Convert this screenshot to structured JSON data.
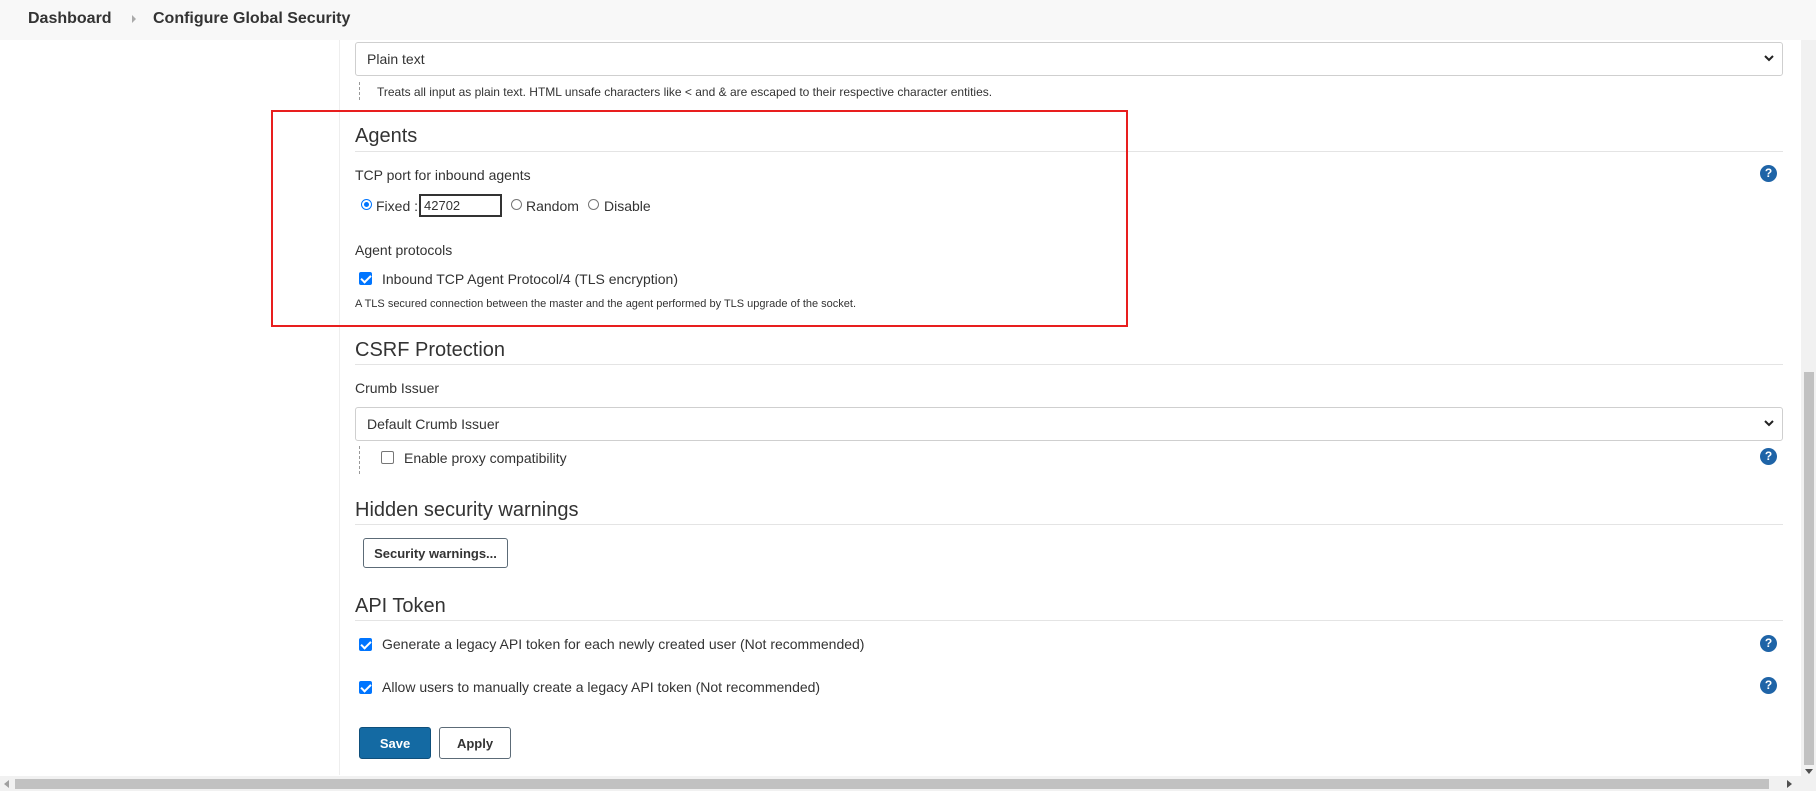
{
  "breadcrumb": {
    "items": [
      "Dashboard",
      "Configure Global Security"
    ]
  },
  "markup_formatter": {
    "selected": "Plain text",
    "description": "Treats all input as plain text. HTML unsafe characters like < and & are escaped to their respective character entities."
  },
  "agents": {
    "title": "Agents",
    "tcp_port_label": "TCP port for inbound agents",
    "options": {
      "fixed_label": "Fixed :",
      "fixed_value": "42702",
      "random_label": "Random",
      "disable_label": "Disable",
      "selected": "Fixed"
    },
    "protocols_label": "Agent protocols",
    "protocol": {
      "label": "Inbound TCP Agent Protocol/4 (TLS encryption)",
      "checked": true,
      "description": "A TLS secured connection between the master and the agent performed by TLS upgrade of the socket."
    }
  },
  "csrf": {
    "title": "CSRF Protection",
    "crumb_issuer_label": "Crumb Issuer",
    "crumb_issuer_selected": "Default Crumb Issuer",
    "proxy_compat_label": "Enable proxy compatibility",
    "proxy_compat_checked": false
  },
  "hidden_warnings": {
    "title": "Hidden security warnings",
    "button_label": "Security warnings..."
  },
  "api_token": {
    "title": "API Token",
    "legacy_generate_label": "Generate a legacy API token for each newly created user (Not recommended)",
    "legacy_generate_checked": true,
    "legacy_manual_label": "Allow users to manually create a legacy API token (Not recommended)",
    "legacy_manual_checked": true
  },
  "actions": {
    "save_label": "Save",
    "apply_label": "Apply"
  },
  "icons": {
    "help": "question-mark-icon",
    "dropdown": "chevron-down-icon"
  },
  "colors": {
    "primary": "#146aa3",
    "help_icon": "#1f64a7",
    "highlight_box": "#e81e1e",
    "checkbox": "#0075ff"
  }
}
